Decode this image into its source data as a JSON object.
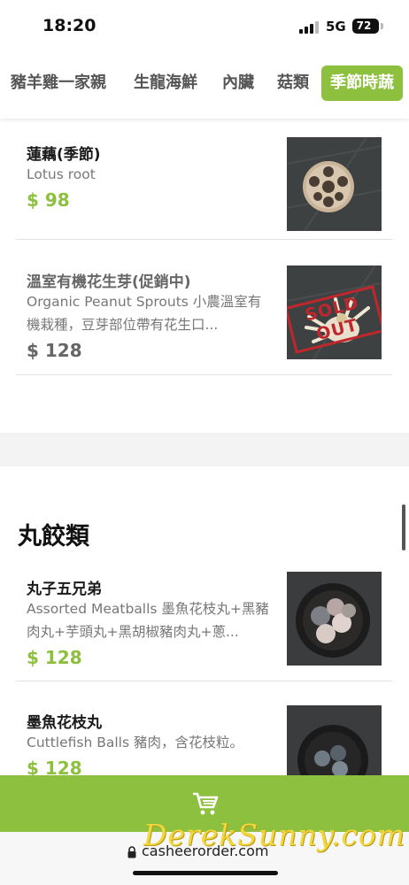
{
  "status": {
    "time": "18:20",
    "network": "5G",
    "battery": "72"
  },
  "tabs": [
    {
      "label": "豬羊雞一家親",
      "active": false
    },
    {
      "label": "生龍海鮮",
      "active": false
    },
    {
      "label": "內臟",
      "active": false
    },
    {
      "label": "菇類",
      "active": false
    },
    {
      "label": "季節時蔬",
      "active": true
    }
  ],
  "items": [
    {
      "name": "蓮藕(季節)",
      "desc": "Lotus root",
      "price": "$ 98",
      "sold_out": false,
      "image": "lotus-root"
    },
    {
      "name": "溫室有機花生芽(促銷中)",
      "desc": "Organic Peanut Sprouts 小農溫室有機栽種，豆芽部位帶有花生口...",
      "price": "$ 128",
      "sold_out": true,
      "sold_out_label": "SOLD OUT",
      "image": "peanut-sprouts"
    }
  ],
  "section": {
    "title": "丸餃類"
  },
  "section_items": [
    {
      "name": "丸子五兄弟",
      "desc": "Assorted Meatballs 墨魚花枝丸+黑豬肉丸+芋頭丸+黑胡椒豬肉丸+蔥...",
      "price": "$ 128",
      "image": "assorted-meatballs"
    },
    {
      "name": "墨魚花枝丸",
      "desc": "Cuttlefish Balls 豬肉，含花枝粒。",
      "price": "$ 128",
      "image": "cuttlefish-balls"
    }
  ],
  "cart": {
    "icon": "cart-icon"
  },
  "browser": {
    "url": "casheerorder.com",
    "watermark": "DerekSunny.com"
  },
  "colors": {
    "accent": "#8dc03e",
    "text": "#1a1a1a",
    "muted": "#777777"
  }
}
